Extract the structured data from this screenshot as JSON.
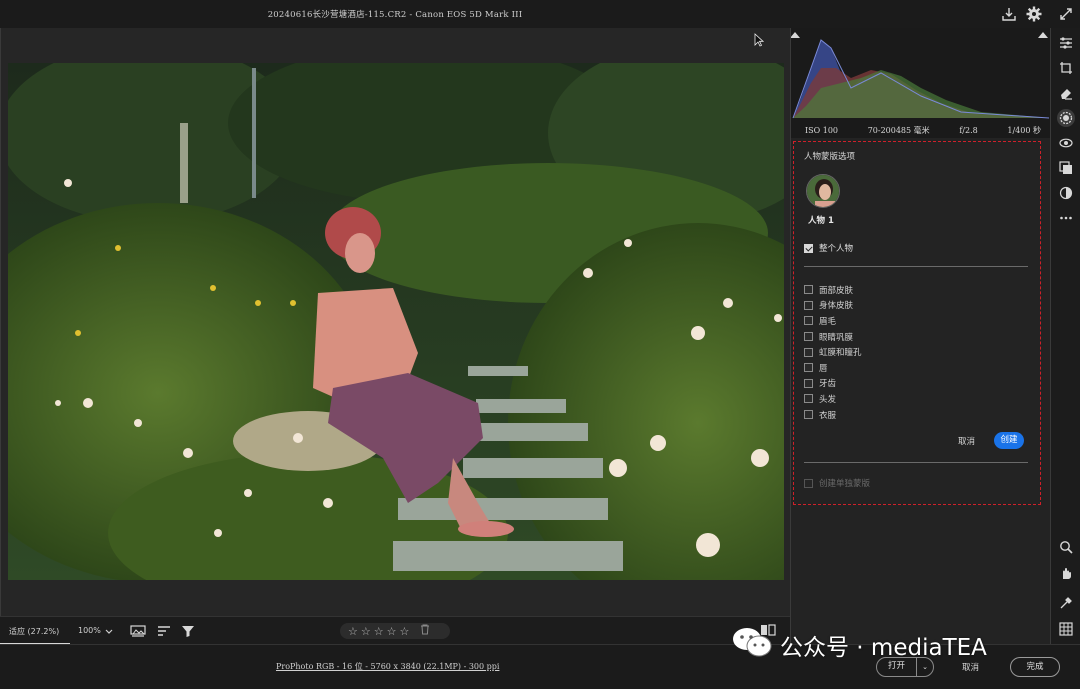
{
  "window": {
    "title": "20240616长沙营塘酒店-115.CR2 -  Canon EOS 5D Mark III"
  },
  "histogram": {
    "iso": "ISO 100",
    "lens": "70-200485 毫米",
    "aperture": "f/2.8",
    "shutter": "1/400 秒"
  },
  "mask_panel": {
    "title": "人物蒙版选项",
    "person_label": "人物 1",
    "whole_person_label": "整个人物",
    "whole_person_checked": true,
    "options": [
      {
        "label": "面部皮肤",
        "checked": false
      },
      {
        "label": "身体皮肤",
        "checked": false
      },
      {
        "label": "眉毛",
        "checked": false
      },
      {
        "label": "眼睛巩膜",
        "checked": false
      },
      {
        "label": "虹膜和瞳孔",
        "checked": false
      },
      {
        "label": "唇",
        "checked": false
      },
      {
        "label": "牙齿",
        "checked": false
      },
      {
        "label": "头发",
        "checked": false
      },
      {
        "label": "衣服",
        "checked": false
      }
    ],
    "cancel_label": "取消",
    "create_label": "创建",
    "separate_label": "创建单独蒙版",
    "accent_color": "#1a73e8",
    "highlight_color": "#d0202a"
  },
  "bottom_toolbar": {
    "fit_label": "适应 (27.2%)",
    "zoom_label": "100%",
    "rating_stars": [
      "☆",
      "☆",
      "☆",
      "☆",
      "☆"
    ]
  },
  "statusbar": {
    "color_info": "ProPhoto RGB - 16 位 - 5760 x 3840 (22.1MP) - 300 ppi",
    "open_label": "打开",
    "cancel_label": "取消",
    "done_label": "完成"
  },
  "watermark": {
    "text": "公众号 · mediaTEA"
  },
  "icons": {
    "toolstrip": [
      "expand-icon",
      "sliders-icon",
      "crop-icon",
      "eraser-icon",
      "mask-icon",
      "redeye-icon",
      "presets-icon",
      "color-icon",
      "more-icon",
      "zoom-icon",
      "hand-icon",
      "eyedropper-icon",
      "grid-icon"
    ],
    "titlebar": [
      "save-icon",
      "settings-icon"
    ]
  }
}
